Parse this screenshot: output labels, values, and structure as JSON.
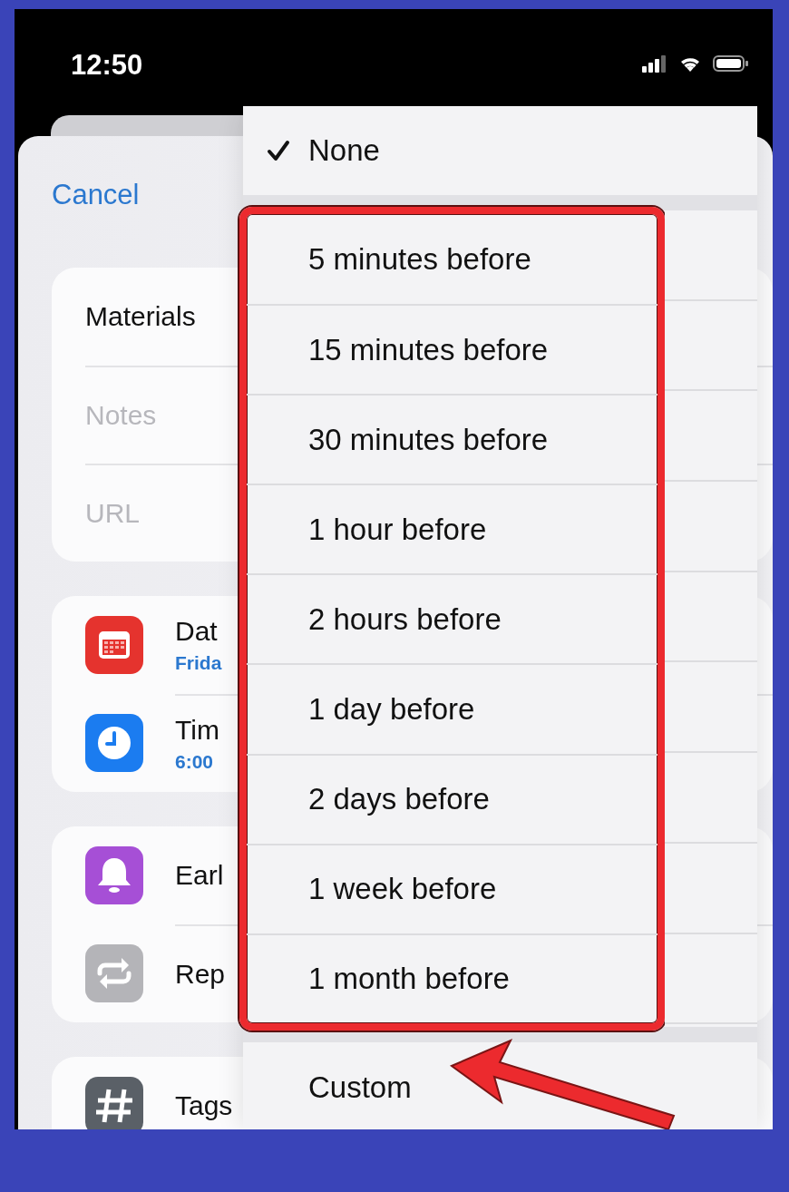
{
  "status_bar": {
    "time": "12:50"
  },
  "cancel": "Cancel",
  "cards": [
    {
      "rows": [
        {
          "kind": "title",
          "title": "Materials"
        },
        {
          "kind": "notes",
          "title": "Notes"
        },
        {
          "kind": "url",
          "title": "URL"
        }
      ]
    },
    {
      "rows": [
        {
          "kind": "date",
          "title": "Dat",
          "subtitle": "Frida",
          "color": "#e5332e"
        },
        {
          "kind": "time",
          "title": "Tim",
          "subtitle": "6:00",
          "color": "#1b7cf0"
        }
      ]
    },
    {
      "rows": [
        {
          "kind": "alert",
          "title": "Earl",
          "color": "#a64fd6"
        },
        {
          "kind": "repeat",
          "title": "Rep",
          "color": "#b4b4b8"
        }
      ]
    },
    {
      "rows": [
        {
          "kind": "tags",
          "title": "Tags",
          "color": "#5a6067"
        }
      ]
    }
  ],
  "menu": {
    "sections": [
      {
        "items": [
          {
            "label": "None",
            "selected": true
          }
        ]
      },
      {
        "highlighted": true,
        "items": [
          {
            "label": "5 minutes before",
            "selected": false
          },
          {
            "label": "15 minutes before",
            "selected": false
          },
          {
            "label": "30 minutes before",
            "selected": false
          },
          {
            "label": "1 hour before",
            "selected": false
          },
          {
            "label": "2 hours before",
            "selected": false
          },
          {
            "label": "1 day before",
            "selected": false
          },
          {
            "label": "2 days before",
            "selected": false
          },
          {
            "label": "1 week before",
            "selected": false
          },
          {
            "label": "1 month before",
            "selected": false
          }
        ]
      },
      {
        "pointed": true,
        "items": [
          {
            "label": "Custom",
            "selected": false
          }
        ]
      }
    ]
  }
}
